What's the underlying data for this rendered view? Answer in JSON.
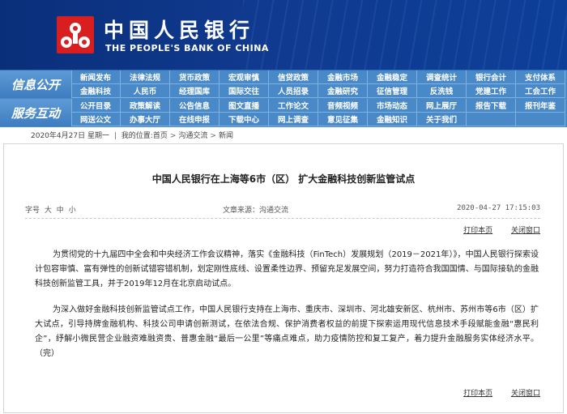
{
  "header": {
    "bank_name_cn": "中国人民银行",
    "bank_name_en": "THE PEOPLE'S BANK OF CHINA",
    "colors": {
      "banner": "#0a2f7a",
      "nav": "#4a89c8",
      "logo_red": "#d81e1e"
    }
  },
  "nav": {
    "section1_label": "信息公开",
    "section2_label": "服务互动",
    "rows": [
      [
        "新闻发布",
        "法律法规",
        "货币政策",
        "宏观审慎",
        "信贷政策",
        "金融市场",
        "金融稳定",
        "调查统计",
        "银行会计",
        "支付体系"
      ],
      [
        "金融科技",
        "人民币",
        "经理国库",
        "国际交往",
        "人员招录",
        "金融研究",
        "征信管理",
        "反洗钱",
        "党建工作",
        "工会工作"
      ],
      [
        "公开目录",
        "政策解读",
        "公告信息",
        "图文直播",
        "工作论文",
        "音频视频",
        "市场动态",
        "网上展厅",
        "报告下载",
        "报刊年鉴"
      ],
      [
        "网送公文",
        "办事大厅",
        "在线申报",
        "下载中心",
        "网上调查",
        "意见征集",
        "金融知识",
        "关于我们",
        "",
        ""
      ]
    ]
  },
  "breadcrumb": {
    "date": "2020年4月27日",
    "weekday": "星期一",
    "location_prefix": "我的位置:",
    "items": [
      "首页",
      "沟通交流",
      "新闻"
    ]
  },
  "article": {
    "title": "中国人民银行在上海等6市（区） 扩大金融科技创新监管试点",
    "font_size_label": "字号",
    "font_sizes": [
      "大",
      "中",
      "小"
    ],
    "source": "文章来源：沟通交流",
    "datetime": "2020-04-27 17:15:03",
    "print_label": "打印本页",
    "close_label": "关闭窗口",
    "paragraphs": [
      "为贯彻党的十九届四中全会和中央经济工作会议精神，落实《金融科技（FinTech）发展规划（2019－2021年）》，中国人民银行探索设计包容审慎、富有弹性的创新试错容错机制，划定刚性底线、设置柔性边界、预留充足发展空间，努力打造符合我国国情、与国际接轨的金融科技创新监管工具，并于2019年12月在北京启动试点。",
      "为深入做好金融科技创新监管试点工作，中国人民银行支持在上海市、重庆市、深圳市、河北雄安新区、杭州市、苏州市等6市（区）扩大试点，引导持牌金融机构、科技公司申请创新测试，在依法合规、保护消费者权益的前提下探索运用现代信息技术手段赋能金融“惠民利企”，纾解小微民营企业融资难融资贵、普惠金融“最后一公里”等痛点难点，助力疫情防控和复工复产，着力提升金融服务实体经济水平。（完）"
    ]
  }
}
